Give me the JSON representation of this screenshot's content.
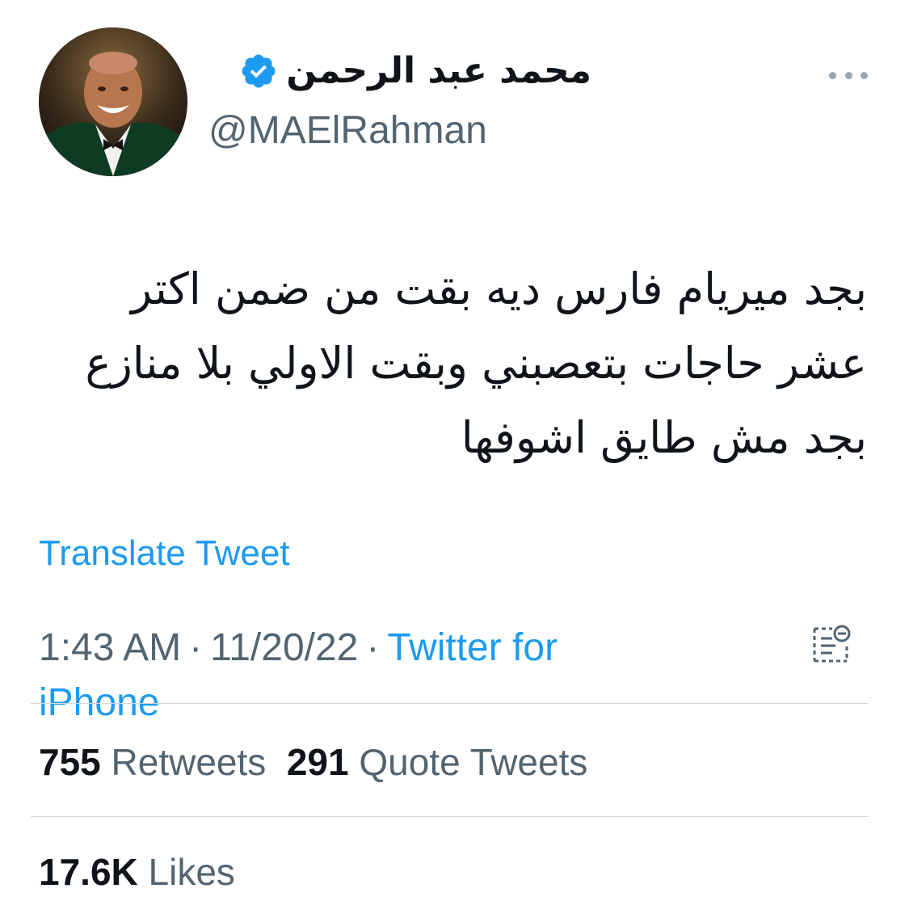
{
  "author": {
    "display_name": "محمد عبد الرحمن",
    "handle": "@MAElRahman",
    "verified": true,
    "verified_icon": "verified-badge-icon"
  },
  "more_icon": "more-horizontal-icon",
  "tweet": {
    "text": "بجد ميريام فارس ديه بقت من ضمن اكتر عشر حاجات بتعصبني وبقت الاولي بلا منازع بجد مش طايق اشوفها",
    "translate_label": "Translate Tweet"
  },
  "meta": {
    "time": "1:43 AM",
    "date": "11/20/22",
    "source_prefix": "Twitter for",
    "source_suffix": "iPhone",
    "separator": "·",
    "analytics_icon": "tweet-analytics-icon"
  },
  "stats": {
    "retweets_count": "755",
    "retweets_label": "Retweets",
    "quotes_count": "291",
    "quotes_label": "Quote Tweets",
    "likes_count": "17.6K",
    "likes_label": "Likes"
  },
  "colors": {
    "accent": "#1d9bf0",
    "text": "#0f1419",
    "secondary": "#536471",
    "divider": "#cfd9de"
  }
}
